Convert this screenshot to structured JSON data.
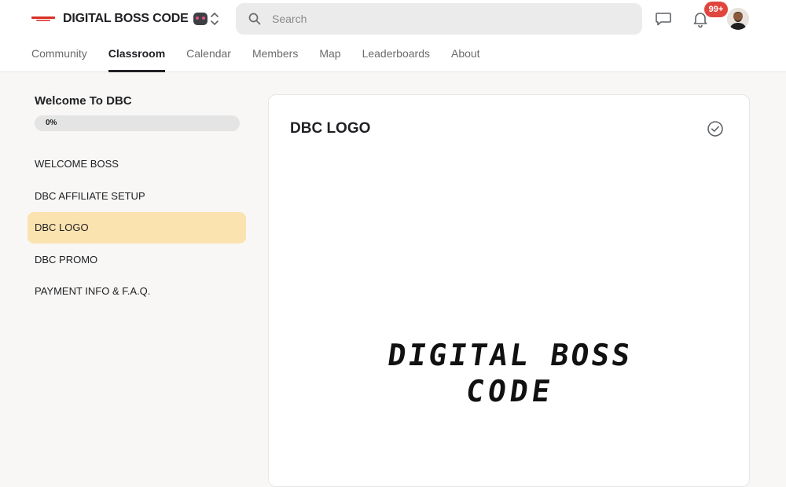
{
  "header": {
    "brand_name": "DIGITAL BOSS CODE",
    "search_placeholder": "Search",
    "notification_count": "99+"
  },
  "nav": {
    "tabs": [
      {
        "label": "Community"
      },
      {
        "label": "Classroom"
      },
      {
        "label": "Calendar"
      },
      {
        "label": "Members"
      },
      {
        "label": "Map"
      },
      {
        "label": "Leaderboards"
      },
      {
        "label": "About"
      }
    ],
    "active_tab": "Classroom"
  },
  "sidebar": {
    "course_title": "Welcome To DBC",
    "progress_label": "0%",
    "progress_fraction": 0,
    "lessons": [
      {
        "label": "WELCOME BOSS"
      },
      {
        "label": "DBC AFFILIATE SETUP"
      },
      {
        "label": "DBC LOGO"
      },
      {
        "label": "DBC PROMO"
      },
      {
        "label": "PAYMENT INFO & F.A.Q."
      }
    ],
    "active_lesson": "DBC LOGO"
  },
  "lesson": {
    "title": "DBC LOGO",
    "logo_line1": "DIGITAL BOSS",
    "logo_line2": "CODE"
  },
  "colors": {
    "accent_highlight": "#fbe3b0",
    "badge": "#e0463e",
    "brand_red": "#d93025",
    "search_bg": "#ebebeb"
  },
  "icons": {
    "brand": "red-streak-logo-icon",
    "switcher": "chevron-up-down-icon",
    "search": "search-icon",
    "chat": "chat-bubble-icon",
    "notifications": "bell-icon",
    "complete": "check-circle-icon"
  }
}
